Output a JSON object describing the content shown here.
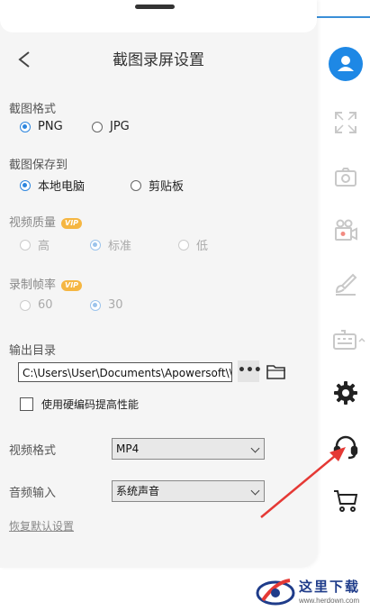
{
  "window": {
    "title": "截图录屏设置"
  },
  "sections": {
    "format": {
      "label": "截图格式",
      "options": [
        "PNG",
        "JPG"
      ],
      "selected": "PNG"
    },
    "save_to": {
      "label": "截图保存到",
      "options": [
        "本地电脑",
        "剪贴板"
      ],
      "selected": "本地电脑"
    },
    "video_quality": {
      "label": "视频质量",
      "badge": "VIP",
      "options": [
        "高",
        "标准",
        "低"
      ],
      "selected": "标准"
    },
    "frame_rate": {
      "label": "录制帧率",
      "badge": "VIP",
      "options": [
        "60",
        "30"
      ],
      "selected": "30"
    },
    "output_dir": {
      "label": "输出目录",
      "value": "C:\\Users\\User\\Documents\\Apowersoft\\\\",
      "more_label": "•••"
    },
    "hw_encode": {
      "label": "使用硬编码提高性能",
      "checked": false
    },
    "video_format": {
      "label": "视频格式",
      "value": "MP4"
    },
    "audio_input": {
      "label": "音频输入",
      "value": "系统声音"
    },
    "reset_label": "恢复默认设置"
  },
  "sidebar": {
    "icons": [
      "user-icon",
      "fullscreen-icon",
      "camera-icon",
      "video-camera-icon",
      "brush-icon",
      "keyboard-icon",
      "gear-icon",
      "headset-icon",
      "cart-icon"
    ]
  },
  "watermark": {
    "text": "这里下载",
    "url": "www.herdown.com"
  },
  "colors": {
    "accent": "#2e86de",
    "vip": "#f5b642",
    "arrow": "#e53935"
  }
}
